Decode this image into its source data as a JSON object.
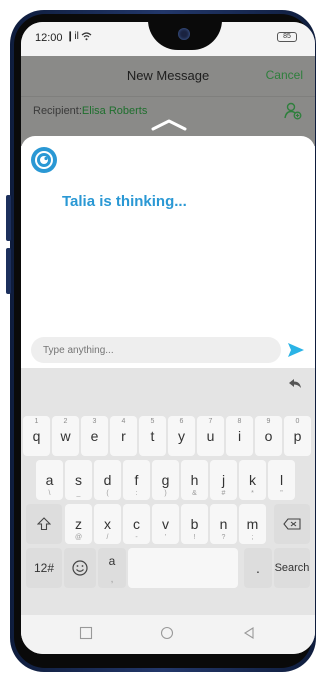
{
  "status": {
    "time": "12:00",
    "signal": "❙il",
    "battery": "85"
  },
  "header": {
    "title": "New Message",
    "cancel_label": "Cancel"
  },
  "recipient": {
    "label": "Recipient:",
    "name": "Elisa Roberts"
  },
  "assistant": {
    "status_text": "Talia is thinking..."
  },
  "compose": {
    "placeholder": "Type anything..."
  },
  "colors": {
    "accent_green": "#2e7f3c",
    "talia_blue": "#2a98d4",
    "send_blue": "#2ab3e6"
  },
  "keyboard": {
    "row1": [
      {
        "k": "q",
        "h": "1"
      },
      {
        "k": "w",
        "h": "2"
      },
      {
        "k": "e",
        "h": "3"
      },
      {
        "k": "r",
        "h": "4"
      },
      {
        "k": "t",
        "h": "5"
      },
      {
        "k": "y",
        "h": "6"
      },
      {
        "k": "u",
        "h": "7"
      },
      {
        "k": "i",
        "h": "8"
      },
      {
        "k": "o",
        "h": "9"
      },
      {
        "k": "p",
        "h": "0"
      }
    ],
    "row2": [
      {
        "k": "a",
        "s": "\\"
      },
      {
        "k": "s",
        "s": "_"
      },
      {
        "k": "d",
        "s": "("
      },
      {
        "k": "f",
        "s": ":"
      },
      {
        "k": "g",
        "s": ")"
      },
      {
        "k": "h",
        "s": "&"
      },
      {
        "k": "j",
        "s": "#"
      },
      {
        "k": "k",
        "s": "*"
      },
      {
        "k": "l",
        "s": "\""
      }
    ],
    "row3": [
      {
        "k": "z",
        "s": "@"
      },
      {
        "k": "x",
        "s": "/"
      },
      {
        "k": "c",
        "s": "-"
      },
      {
        "k": "v",
        "s": "'"
      },
      {
        "k": "b",
        "s": "!"
      },
      {
        "k": "n",
        "s": "?"
      },
      {
        "k": "m",
        "s": ";"
      }
    ],
    "symbols_label": "12#",
    "lang_label": "a",
    "lang_sub": ",",
    "period_label": ".",
    "search_label": "Search",
    "shift_icon": "shift-icon",
    "backspace_icon": "backspace-icon",
    "emoji_icon": "emoji-icon"
  }
}
